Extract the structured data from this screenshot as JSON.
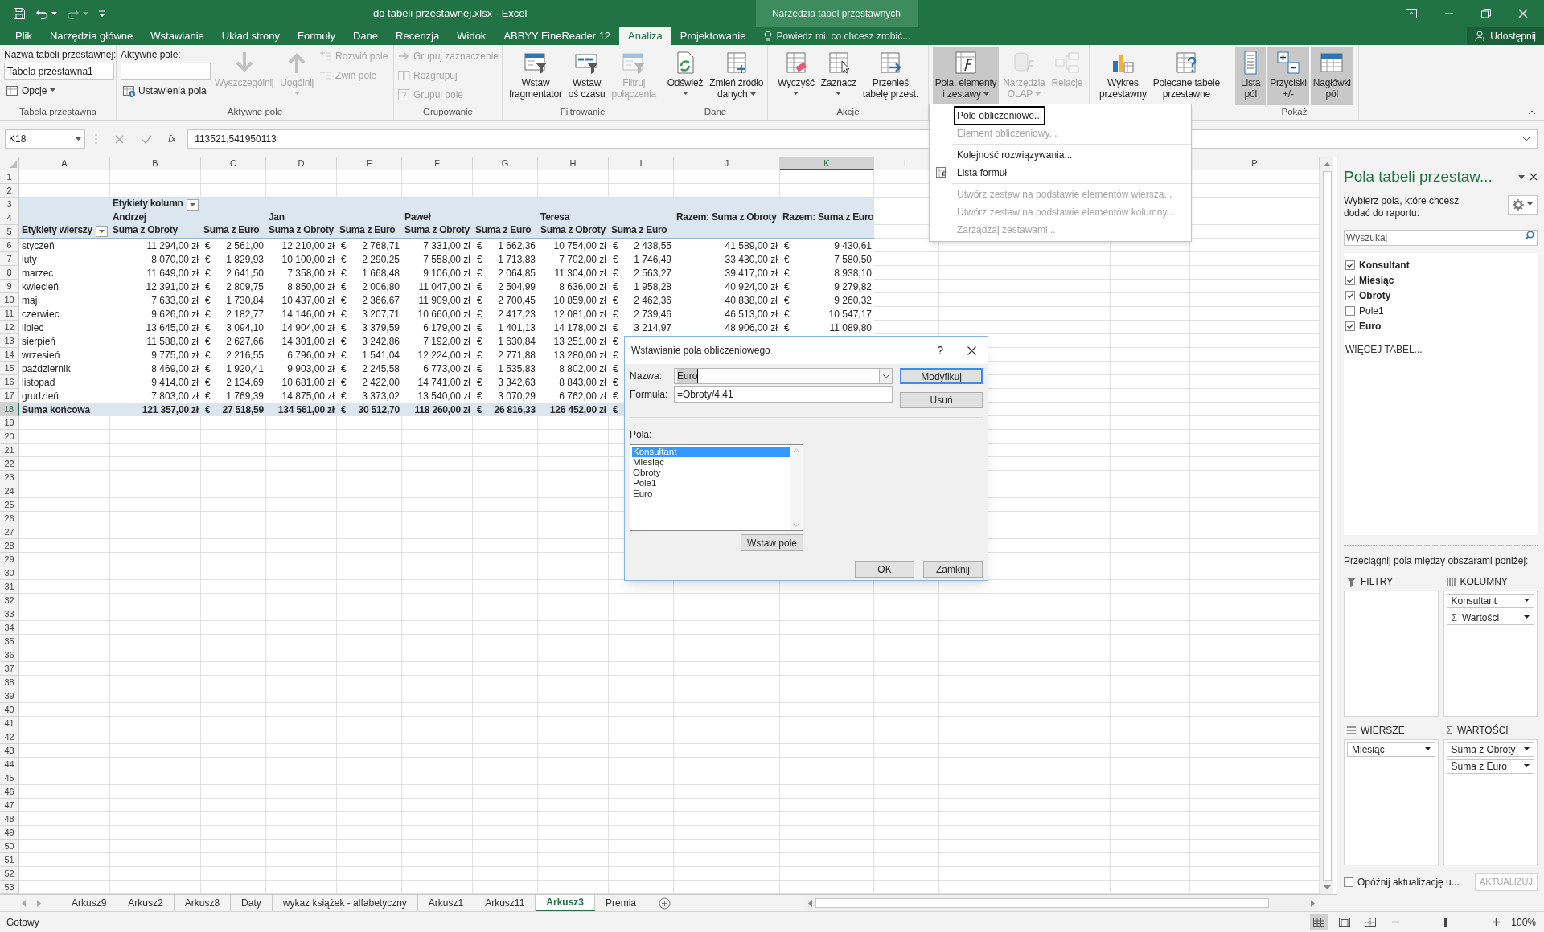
{
  "title_bar": {
    "title": "do tabeli przestawnej.xlsx - Excel",
    "context_label": "Narzędzia tabel przestawnych"
  },
  "ribbon_tabs": [
    {
      "label": "Plik",
      "selected": false
    },
    {
      "label": "Narzędzia główne",
      "selected": false
    },
    {
      "label": "Wstawianie",
      "selected": false
    },
    {
      "label": "Układ strony",
      "selected": false
    },
    {
      "label": "Formuły",
      "selected": false
    },
    {
      "label": "Dane",
      "selected": false
    },
    {
      "label": "Recenzja",
      "selected": false
    },
    {
      "label": "Widok",
      "selected": false
    },
    {
      "label": "ABBYY FineReader 12",
      "selected": false
    },
    {
      "label": "Analiza",
      "selected": true
    },
    {
      "label": "Projektowanie",
      "selected": false
    }
  ],
  "tell_me": {
    "placeholder": "Powiedz mi, co chcesz zrobić..."
  },
  "share_button": "Udostępnij",
  "ribbon_groups": [
    {
      "label": "Tabela przestawna",
      "controls": [
        {
          "kind": "text",
          "label": "Nazwa tabeli przestawnej:"
        },
        {
          "kind": "input",
          "value": "Tabela przestawna1"
        },
        {
          "kind": "small",
          "label": "Opcje",
          "dropdown": true,
          "disabled": false
        }
      ]
    },
    {
      "label": "Aktywne pole",
      "controls": [
        {
          "kind": "text",
          "label": "Aktywne pole:"
        },
        {
          "kind": "input"
        },
        {
          "kind": "small",
          "label": "Ustawienia pola",
          "dropdown": false,
          "disabled": false
        },
        {
          "kind": "large",
          "lines": [
            "Wyszczególnij"
          ],
          "dropdown": false,
          "disabled": true,
          "pressed": false
        },
        {
          "kind": "large",
          "lines": [
            "Uogólnij"
          ],
          "dropdown": true,
          "disabled": true,
          "pressed": false
        },
        {
          "kind": "small",
          "label": "Rozwiń pole",
          "dropdown": false,
          "disabled": true
        },
        {
          "kind": "small",
          "label": "Zwiń pole",
          "dropdown": false,
          "disabled": true
        }
      ]
    },
    {
      "label": "Grupowanie",
      "controls": [
        {
          "kind": "small",
          "label": "Grupuj zaznaczenie",
          "dropdown": false,
          "disabled": true
        },
        {
          "kind": "small",
          "label": "Rozgrupuj",
          "dropdown": false,
          "disabled": true
        },
        {
          "kind": "small",
          "label": "Grupuj pole",
          "dropdown": false,
          "disabled": true
        }
      ]
    },
    {
      "label": "Filtrowanie",
      "controls": [
        {
          "kind": "large",
          "lines": [
            "Wstaw",
            "fragmentator"
          ],
          "dropdown": false,
          "disabled": false,
          "pressed": false
        },
        {
          "kind": "large",
          "lines": [
            "Wstaw",
            "oś czasu"
          ],
          "dropdown": false,
          "disabled": false,
          "pressed": false
        },
        {
          "kind": "large",
          "lines": [
            "Filtruj",
            "połączenia"
          ],
          "dropdown": false,
          "disabled": true,
          "pressed": false
        }
      ]
    },
    {
      "label": "Dane",
      "controls": [
        {
          "kind": "large",
          "lines": [
            "Odśwież"
          ],
          "dropdown": true,
          "disabled": false,
          "pressed": false
        },
        {
          "kind": "large",
          "lines": [
            "Zmień źródło",
            "danych"
          ],
          "dropdown": true,
          "disabled": false,
          "pressed": false
        }
      ]
    },
    {
      "label": "Akcje",
      "controls": [
        {
          "kind": "large",
          "lines": [
            "Wyczyść"
          ],
          "dropdown": true,
          "disabled": false,
          "pressed": false
        },
        {
          "kind": "large",
          "lines": [
            "Zaznacz"
          ],
          "dropdown": true,
          "disabled": false,
          "pressed": false
        },
        {
          "kind": "large",
          "lines": [
            "Przenieś",
            "tabelę przest."
          ],
          "dropdown": false,
          "disabled": false,
          "pressed": false
        }
      ]
    },
    {
      "controls": [
        {
          "kind": "large",
          "lines": [
            "Pola, elementy",
            "i zestawy"
          ],
          "dropdown": true,
          "disabled": false,
          "pressed": true
        },
        {
          "kind": "large",
          "lines": [
            "Narzędzia",
            "OLAP"
          ],
          "dropdown": true,
          "disabled": true,
          "pressed": false
        },
        {
          "kind": "large",
          "lines": [
            "Relacje"
          ],
          "dropdown": false,
          "disabled": true,
          "pressed": false
        }
      ]
    },
    {
      "controls": [
        {
          "kind": "large",
          "lines": [
            "Wykres",
            "przestawny"
          ],
          "dropdown": false,
          "disabled": false,
          "pressed": false
        },
        {
          "kind": "large",
          "lines": [
            "Polecane tabele",
            "przestawne"
          ],
          "dropdown": false,
          "disabled": false,
          "pressed": false
        }
      ]
    },
    {
      "label": "Pokaż",
      "controls": [
        {
          "kind": "large",
          "lines": [
            "Lista",
            "pól"
          ],
          "dropdown": false,
          "disabled": false,
          "pressed": true
        },
        {
          "kind": "large",
          "lines": [
            "Przyciski",
            "+/-"
          ],
          "dropdown": false,
          "disabled": false,
          "pressed": true
        },
        {
          "kind": "large",
          "lines": [
            "Nagłówki",
            "pól"
          ],
          "dropdown": false,
          "disabled": false,
          "pressed": true
        }
      ]
    }
  ],
  "calculations_menu": {
    "items": [
      {
        "label": "Pole obliczeniowe...",
        "disabled": false,
        "selected": true,
        "separator_before": false
      },
      {
        "label": "Element obliczeniowy...",
        "disabled": true,
        "selected": false,
        "separator_before": false
      },
      {
        "label": "Kolejność rozwiązywania...",
        "disabled": false,
        "selected": false,
        "separator_before": true
      },
      {
        "label": "Lista formuł",
        "disabled": false,
        "selected": false,
        "separator_before": false
      },
      {
        "label": "Utwórz zestaw na podstawie elementów wiersza...",
        "disabled": true,
        "selected": false,
        "separator_before": true
      },
      {
        "label": "Utwórz zestaw na podstawie elementów kolumny...",
        "disabled": true,
        "selected": false,
        "separator_before": false
      },
      {
        "label": "Zarządzaj zestawami...",
        "disabled": true,
        "selected": false,
        "separator_before": false
      }
    ]
  },
  "formula_bar": {
    "name_box": "K18",
    "function_label": "fx",
    "value": "113521,541950113"
  },
  "grid": {
    "columns": [
      {
        "label": "A",
        "selected": false
      },
      {
        "label": "B",
        "selected": false
      },
      {
        "label": "C",
        "selected": false
      },
      {
        "label": "D",
        "selected": false
      },
      {
        "label": "E",
        "selected": false
      },
      {
        "label": "F",
        "selected": false
      },
      {
        "label": "G",
        "selected": false
      },
      {
        "label": "H",
        "selected": false
      },
      {
        "label": "I",
        "selected": false
      },
      {
        "label": "J",
        "selected": false
      },
      {
        "label": "K",
        "selected": true
      },
      {
        "label": "L",
        "selected": false
      },
      {
        "label": "P",
        "selected": false
      }
    ],
    "rows": [
      {
        "number": "1",
        "kind": "blank",
        "selected": false
      },
      {
        "number": "2",
        "kind": "blank",
        "selected": false
      },
      {
        "number": "3",
        "kind": "header",
        "selected": false,
        "cells": [
          {
            "kind": "empty"
          },
          {
            "kind": "label",
            "text": "Etykiety kolumn",
            "filter": true
          }
        ]
      },
      {
        "number": "4",
        "kind": "header",
        "selected": false,
        "cells": [
          {
            "kind": "empty"
          },
          {
            "kind": "label",
            "text": "Andrzej",
            "filter": false
          },
          {
            "kind": "empty"
          },
          {
            "kind": "label",
            "text": "Jan",
            "filter": false
          },
          {
            "kind": "empty"
          },
          {
            "kind": "label",
            "text": "Paweł",
            "filter": false
          },
          {
            "kind": "empty"
          },
          {
            "kind": "label",
            "text": "Teresa",
            "filter": false
          },
          {
            "kind": "empty"
          },
          {
            "kind": "label",
            "text": "Razem: Suma z Obroty",
            "filter": false
          },
          {
            "kind": "label",
            "text": "Razem: Suma z Euro",
            "filter": false
          }
        ]
      },
      {
        "number": "5",
        "kind": "header",
        "selected": false,
        "cells": [
          {
            "kind": "label",
            "text": "Etykiety wierszy",
            "filter": true
          },
          {
            "kind": "label",
            "text": "Suma z Obroty",
            "filter": false
          },
          {
            "kind": "label",
            "text": "Suma z Euro",
            "filter": false
          },
          {
            "kind": "label",
            "text": "Suma z Obroty",
            "filter": false
          },
          {
            "kind": "label",
            "text": "Suma z Euro",
            "filter": false
          },
          {
            "kind": "label",
            "text": "Suma z Obroty",
            "filter": false
          },
          {
            "kind": "label",
            "text": "Suma z Euro",
            "filter": false
          },
          {
            "kind": "label",
            "text": "Suma z Obroty",
            "filter": false
          },
          {
            "kind": "label",
            "text": "Suma z Euro",
            "filter": false
          }
        ]
      },
      {
        "number": "6",
        "kind": "data",
        "selected": false,
        "cells": [
          "styczeń",
          "11 294,00 zł",
          {
            "currency": "€",
            "amount": "2 561,00"
          },
          "12 210,00 zł",
          {
            "currency": "€",
            "amount": "2 768,71"
          },
          "7 331,00 zł",
          {
            "currency": "€",
            "amount": "1 662,36"
          },
          "10 754,00 zł",
          {
            "currency": "€",
            "amount": "2 438,55"
          },
          "41 589,00 zł",
          {
            "currency": "€",
            "amount": "9 430,61"
          }
        ]
      },
      {
        "number": "7",
        "kind": "data",
        "selected": false,
        "cells": [
          "luty",
          "8 070,00 zł",
          {
            "currency": "€",
            "amount": "1 829,93"
          },
          "10 100,00 zł",
          {
            "currency": "€",
            "amount": "2 290,25"
          },
          "7 558,00 zł",
          {
            "currency": "€",
            "amount": "1 713,83"
          },
          "7 702,00 zł",
          {
            "currency": "€",
            "amount": "1 746,49"
          },
          "33 430,00 zł",
          {
            "currency": "€",
            "amount": "7 580,50"
          }
        ]
      },
      {
        "number": "8",
        "kind": "data",
        "selected": false,
        "cells": [
          "marzec",
          "11 649,00 zł",
          {
            "currency": "€",
            "amount": "2 641,50"
          },
          "7 358,00 zł",
          {
            "currency": "€",
            "amount": "1 668,48"
          },
          "9 106,00 zł",
          {
            "currency": "€",
            "amount": "2 064,85"
          },
          "11 304,00 zł",
          {
            "currency": "€",
            "amount": "2 563,27"
          },
          "39 417,00 zł",
          {
            "currency": "€",
            "amount": "8 938,10"
          }
        ]
      },
      {
        "number": "9",
        "kind": "data",
        "selected": false,
        "cells": [
          "kwiecień",
          "12 391,00 zł",
          {
            "currency": "€",
            "amount": "2 809,75"
          },
          "8 850,00 zł",
          {
            "currency": "€",
            "amount": "2 006,80"
          },
          "11 047,00 zł",
          {
            "currency": "€",
            "amount": "2 504,99"
          },
          "8 636,00 zł",
          {
            "currency": "€",
            "amount": "1 958,28"
          },
          "40 924,00 zł",
          {
            "currency": "€",
            "amount": "9 279,82"
          }
        ]
      },
      {
        "number": "10",
        "kind": "data",
        "selected": false,
        "cells": [
          "maj",
          "7 633,00 zł",
          {
            "currency": "€",
            "amount": "1 730,84"
          },
          "10 437,00 zł",
          {
            "currency": "€",
            "amount": "2 366,67"
          },
          "11 909,00 zł",
          {
            "currency": "€",
            "amount": "2 700,45"
          },
          "10 859,00 zł",
          {
            "currency": "€",
            "amount": "2 462,36"
          },
          "40 838,00 zł",
          {
            "currency": "€",
            "amount": "9 260,32"
          }
        ]
      },
      {
        "number": "11",
        "kind": "data",
        "selected": false,
        "cells": [
          "czerwiec",
          "9 626,00 zł",
          {
            "currency": "€",
            "amount": "2 182,77"
          },
          "14 146,00 zł",
          {
            "currency": "€",
            "amount": "3 207,71"
          },
          "10 660,00 zł",
          {
            "currency": "€",
            "amount": "2 417,23"
          },
          "12 081,00 zł",
          {
            "currency": "€",
            "amount": "2 739,46"
          },
          "46 513,00 zł",
          {
            "currency": "€",
            "amount": "10 547,17"
          }
        ]
      },
      {
        "number": "12",
        "kind": "data",
        "selected": false,
        "cells": [
          "lipiec",
          "13 645,00 zł",
          {
            "currency": "€",
            "amount": "3 094,10"
          },
          "14 904,00 zł",
          {
            "currency": "€",
            "amount": "3 379,59"
          },
          "6 179,00 zł",
          {
            "currency": "€",
            "amount": "1 401,13"
          },
          "14 178,00 zł",
          {
            "currency": "€",
            "amount": "3 214,97"
          },
          "48 906,00 zł",
          {
            "currency": "€",
            "amount": "11 089,80"
          }
        ]
      },
      {
        "number": "13",
        "kind": "data",
        "selected": false,
        "cells": [
          "sierpień",
          "11 588,00 zł",
          {
            "currency": "€",
            "amount": "2 627,66"
          },
          "14 301,00 zł",
          {
            "currency": "€",
            "amount": "3 242,86"
          },
          "7 192,00 zł",
          {
            "currency": "€",
            "amount": "1 630,84"
          },
          "13 251,00 zł",
          {
            "currency": "€"
          }
        ]
      },
      {
        "number": "14",
        "kind": "data",
        "selected": false,
        "cells": [
          "wrzesień",
          "9 775,00 zł",
          {
            "currency": "€",
            "amount": "2 216,55"
          },
          "6 796,00 zł",
          {
            "currency": "€",
            "amount": "1 541,04"
          },
          "12 224,00 zł",
          {
            "currency": "€",
            "amount": "2 771,88"
          },
          "13 280,00 zł",
          {
            "currency": "€"
          }
        ]
      },
      {
        "number": "15",
        "kind": "data",
        "selected": false,
        "cells": [
          "październik",
          "8 469,00 zł",
          {
            "currency": "€",
            "amount": "1 920,41"
          },
          "9 903,00 zł",
          {
            "currency": "€",
            "amount": "2 245,58"
          },
          "6 773,00 zł",
          {
            "currency": "€",
            "amount": "1 535,83"
          },
          "8 802,00 zł",
          {
            "currency": "€"
          }
        ]
      },
      {
        "number": "16",
        "kind": "data",
        "selected": false,
        "cells": [
          "listopad",
          "9 414,00 zł",
          {
            "currency": "€",
            "amount": "2 134,69"
          },
          "10 681,00 zł",
          {
            "currency": "€",
            "amount": "2 422,00"
          },
          "14 741,00 zł",
          {
            "currency": "€",
            "amount": "3 342,63"
          },
          "8 843,00 zł",
          {
            "currency": "€"
          }
        ]
      },
      {
        "number": "17",
        "kind": "data",
        "selected": false,
        "cells": [
          "grudzień",
          "7 803,00 zł",
          {
            "currency": "€",
            "amount": "1 769,39"
          },
          "14 875,00 zł",
          {
            "currency": "€",
            "amount": "3 373,02"
          },
          "13 540,00 zł",
          {
            "currency": "€",
            "amount": "3 070,29"
          },
          "6 762,00 zł",
          {
            "currency": "€"
          }
        ]
      },
      {
        "number": "18",
        "kind": "total",
        "selected": true,
        "cells": [
          "Suma końcowa",
          "121 357,00 zł",
          {
            "currency": "€",
            "amount": "27 518,59"
          },
          "134 561,00 zł",
          {
            "currency": "€",
            "amount": "30 512,70"
          },
          "118 260,00 zł",
          {
            "currency": "€",
            "amount": "26 816,33"
          },
          "126 452,00 zł",
          {
            "currency": "€"
          }
        ]
      },
      {
        "number": "19",
        "kind": "blank",
        "selected": false
      },
      {
        "number": "20",
        "kind": "blank",
        "selected": false
      },
      {
        "number": "21",
        "kind": "blank",
        "selected": false
      },
      {
        "number": "22",
        "kind": "blank",
        "selected": false
      },
      {
        "number": "23",
        "kind": "blank",
        "selected": false
      },
      {
        "number": "24",
        "kind": "blank",
        "selected": false
      },
      {
        "number": "25",
        "kind": "blank",
        "selected": false
      },
      {
        "number": "26",
        "kind": "blank",
        "selected": false
      },
      {
        "number": "27",
        "kind": "blank",
        "selected": false
      },
      {
        "number": "28",
        "kind": "blank",
        "selected": false
      },
      {
        "number": "29",
        "kind": "blank",
        "selected": false
      },
      {
        "number": "30",
        "kind": "blank",
        "selected": false
      },
      {
        "number": "31",
        "kind": "blank",
        "selected": false
      },
      {
        "number": "32",
        "kind": "blank",
        "selected": false
      },
      {
        "number": "33",
        "kind": "blank",
        "selected": false
      },
      {
        "number": "34",
        "kind": "blank",
        "selected": false
      },
      {
        "number": "35",
        "kind": "blank",
        "selected": false
      },
      {
        "number": "36",
        "kind": "blank",
        "selected": false
      },
      {
        "number": "37",
        "kind": "blank",
        "selected": false
      },
      {
        "number": "38",
        "kind": "blank",
        "selected": false
      },
      {
        "number": "39",
        "kind": "blank",
        "selected": false
      },
      {
        "number": "40",
        "kind": "blank",
        "selected": false
      },
      {
        "number": "41",
        "kind": "blank",
        "selected": false
      },
      {
        "number": "42",
        "kind": "blank",
        "selected": false
      },
      {
        "number": "43",
        "kind": "blank",
        "selected": false
      },
      {
        "number": "44",
        "kind": "blank",
        "selected": false
      },
      {
        "number": "45",
        "kind": "blank",
        "selected": false
      },
      {
        "number": "46",
        "kind": "blank",
        "selected": false
      },
      {
        "number": "47",
        "kind": "blank",
        "selected": false
      },
      {
        "number": "48",
        "kind": "blank",
        "selected": false
      },
      {
        "number": "49",
        "kind": "blank",
        "selected": false
      },
      {
        "number": "50",
        "kind": "blank",
        "selected": false
      },
      {
        "number": "51",
        "kind": "blank",
        "selected": false
      },
      {
        "number": "52",
        "kind": "blank",
        "selected": false
      },
      {
        "number": "53",
        "kind": "blank",
        "selected": false
      }
    ]
  },
  "dialog": {
    "title": "Wstawianie pola obliczeniowego",
    "help": "?",
    "name_label": "Nazwa:",
    "name_value": "Euro",
    "formula_label": "Formuła:",
    "formula_value": "=Obroty/4,41",
    "side_buttons": [
      {
        "label": "Modyfikuj",
        "default": true
      },
      {
        "label": "Usuń",
        "default": false
      }
    ],
    "fields_label": "Pola:",
    "fields": [
      {
        "label": "Konsultant",
        "selected": true
      },
      {
        "label": "Miesiąc",
        "selected": false
      },
      {
        "label": "Obroty",
        "selected": false
      },
      {
        "label": "Pole1",
        "selected": false
      },
      {
        "label": "Euro",
        "selected": false
      }
    ],
    "insert_button": "Wstaw pole",
    "footer_buttons": [
      "OK",
      "Zamknij"
    ]
  },
  "field_list": {
    "title": "Pola tabeli przestaw...",
    "instruction": "Wybierz pola, które chcesz dodać do raportu:",
    "search": {
      "placeholder": "Wyszukaj"
    },
    "fields": [
      {
        "label": "Konsultant",
        "checked": true
      },
      {
        "label": "Miesiąc",
        "checked": true
      },
      {
        "label": "Obroty",
        "checked": true
      },
      {
        "label": "Pole1",
        "checked": false
      },
      {
        "label": "Euro",
        "checked": true
      }
    ],
    "more_tables": "WIĘCEJ TABEL...",
    "areas_hint": "Przeciągnij pola między obszarami poniżej:",
    "areas": [
      {
        "label": "FILTRY"
      },
      {
        "label": "KOLUMNY",
        "items": [
          {
            "label": "Konsultant"
          },
          {
            "symbol": "Σ",
            "label": "Wartości"
          }
        ]
      },
      {
        "label": "WIERSZE",
        "items": [
          {
            "label": "Miesiąc"
          }
        ]
      },
      {
        "symbol": "Σ",
        "label": "WARTOŚCI",
        "items": [
          {
            "label": "Suma z Obroty"
          },
          {
            "label": "Suma z Euro"
          }
        ]
      }
    ],
    "defer": {
      "label": "Opóźnij aktualizację u...",
      "checked": false
    },
    "update_button": {
      "label": "AKTUALIZUJ",
      "disabled": true
    }
  },
  "sheet_tabs": [
    {
      "label": "Arkusz9",
      "selected": false
    },
    {
      "label": "Arkusz2",
      "selected": false
    },
    {
      "label": "Arkusz8",
      "selected": false
    },
    {
      "label": "Daty",
      "selected": false
    },
    {
      "label": "wykaz książek - alfabetyczny",
      "selected": false
    },
    {
      "label": "Arkusz1",
      "selected": false
    },
    {
      "label": "Arkusz11",
      "selected": false
    },
    {
      "label": "Arkusz3",
      "selected": true
    },
    {
      "label": "Premia",
      "selected": false
    }
  ],
  "status_bar": {
    "text": "Gotowy",
    "views": [
      {
        "selected": true
      },
      {
        "selected": false
      },
      {
        "selected": false
      }
    ],
    "zoom_slider": {
      "level": 0.5
    },
    "zoom": "100%"
  }
}
